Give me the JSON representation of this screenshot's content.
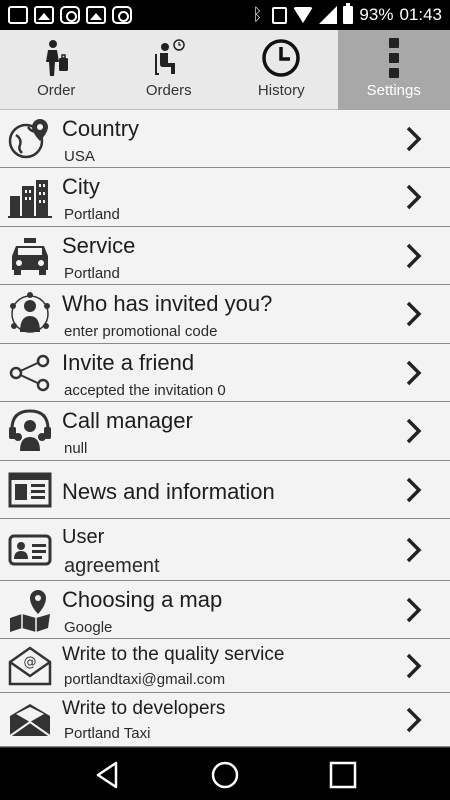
{
  "status_bar": {
    "battery": "93%",
    "time": "01:43"
  },
  "tabs": [
    {
      "label": "Order",
      "icon": "person-with-luggage-icon",
      "active": false
    },
    {
      "label": "Orders",
      "icon": "seated-person-clock-icon",
      "active": false
    },
    {
      "label": "History",
      "icon": "clock-icon",
      "active": false
    },
    {
      "label": "Settings",
      "icon": "menu-dots-icon",
      "active": true
    }
  ],
  "settings": [
    {
      "title": "Country",
      "subtitle": "USA",
      "icon": "globe-pin-icon"
    },
    {
      "title": "City",
      "subtitle": "Portland",
      "icon": "city-buildings-icon"
    },
    {
      "title": "Service",
      "subtitle": "Portland",
      "icon": "taxi-icon"
    },
    {
      "title": "Who has invited you?",
      "subtitle": "enter promotional code",
      "icon": "network-people-icon"
    },
    {
      "title": "Invite a friend",
      "subtitle": "accepted the invitation 0",
      "icon": "share-icon"
    },
    {
      "title": "Call manager",
      "subtitle": "null",
      "icon": "headset-people-icon"
    },
    {
      "title": "News and information",
      "subtitle": "",
      "icon": "newspaper-icon"
    },
    {
      "title": "User",
      "subtitle": "agreement",
      "icon": "id-card-icon"
    },
    {
      "title": "Choosing a map",
      "subtitle": "Google",
      "icon": "map-pin-icon"
    },
    {
      "title": "Write to the quality service",
      "subtitle": "portlandtaxi@gmail.com",
      "icon": "email-at-icon"
    },
    {
      "title": "Write to developers",
      "subtitle": "Portland Taxi",
      "icon": "open-envelope-icon"
    }
  ],
  "nav": {
    "back": "back-icon",
    "home": "home-icon",
    "recents": "recents-icon"
  }
}
